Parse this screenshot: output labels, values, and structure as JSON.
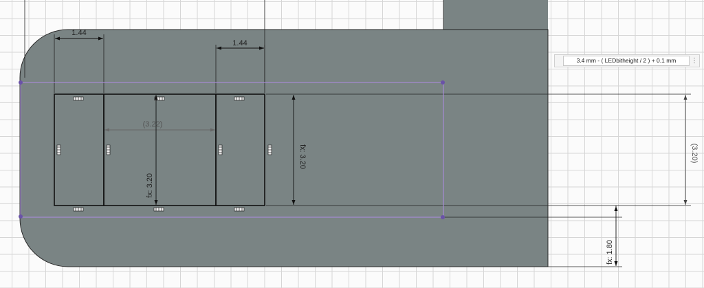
{
  "dimensions": {
    "top_left_width": "1.44",
    "top_right_width": "1.44",
    "middle_width_ref": "(3.22)",
    "inner_height": "fx: 3.20",
    "right_height": "fx: 3.20",
    "far_right_ref": "(3.20)",
    "bottom_offset": "fx: 1.80"
  },
  "param_input": {
    "value": "3.4 mm - ( LEDbitheight / 2 ) + 0.1 mm",
    "menu_glyph": "⋮"
  },
  "colors": {
    "solid_fill": "#7a8484",
    "sketch_line": "#1a1a1a",
    "construction_line": "#a78bd4",
    "point": "#6a52a8"
  }
}
